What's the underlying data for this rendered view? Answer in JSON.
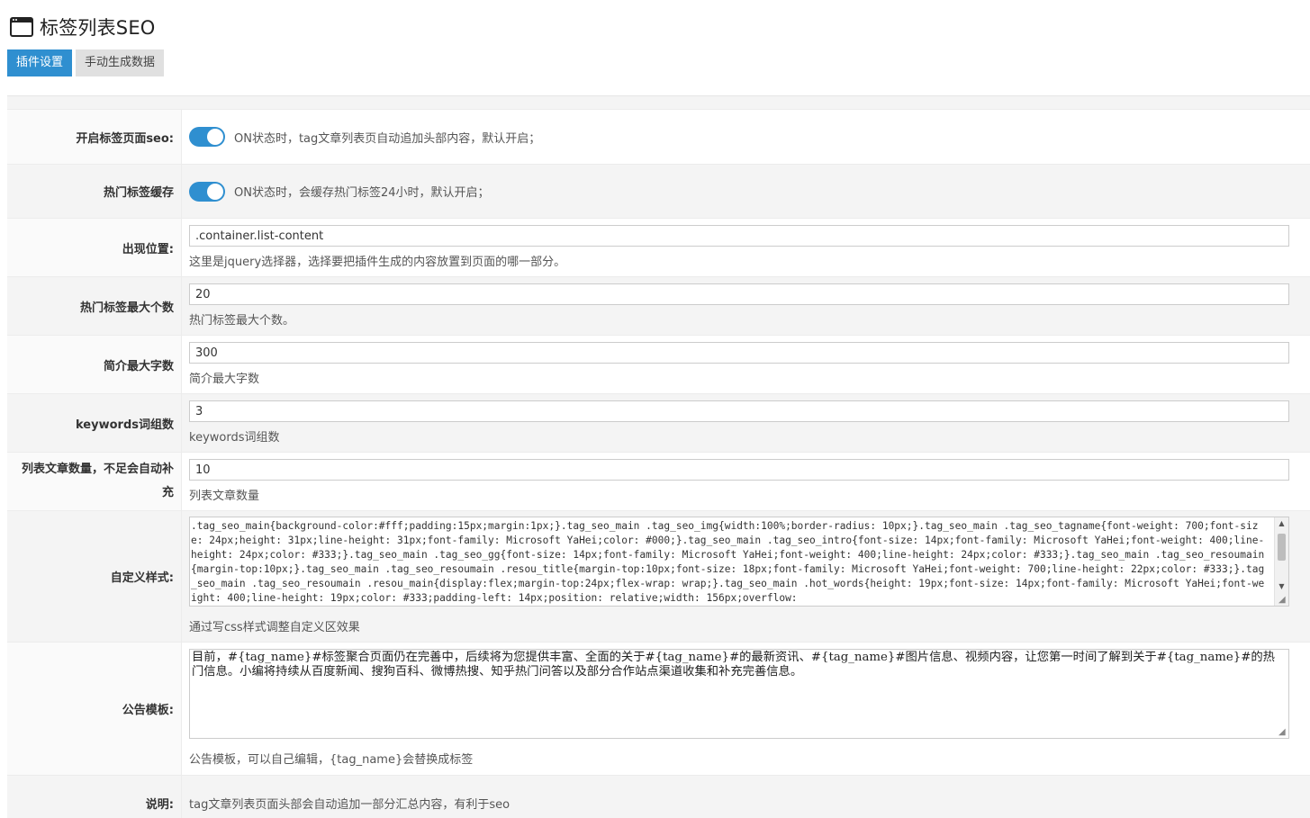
{
  "header": {
    "title": "标签列表SEO",
    "icon": "window-icon"
  },
  "tabs": [
    {
      "label": "插件设置",
      "active": true
    },
    {
      "label": "手动生成数据",
      "active": false
    }
  ],
  "settings": {
    "seo_toggle": {
      "label": "开启标签页面seo:",
      "on": true,
      "desc": "ON状态时，tag文章列表页自动追加头部内容，默认开启；"
    },
    "cache_toggle": {
      "label": "热门标签缓存",
      "on": true,
      "desc": "ON状态时，会缓存热门标签24小时，默认开启；"
    },
    "position": {
      "label": "出现位置:",
      "value": ".container.list-content",
      "help": "这里是jquery选择器，选择要把插件生成的内容放置到页面的哪一部分。"
    },
    "hot_max": {
      "label": "热门标签最大个数",
      "value": "20",
      "help": "热门标签最大个数。"
    },
    "intro_max": {
      "label": "简介最大字数",
      "value": "300",
      "help": "简介最大字数"
    },
    "keywords": {
      "label": "keywords词组数",
      "value": "3",
      "help": "keywords词组数"
    },
    "list_count": {
      "label": "列表文章数量，不足会自动补充",
      "value": "10",
      "help": "列表文章数量"
    },
    "custom_css": {
      "label": "自定义样式:",
      "value": ".tag_seo_main{background-color:#fff;padding:15px;margin:1px;}.tag_seo_main .tag_seo_img{width:100%;border-radius: 10px;}.tag_seo_main .tag_seo_tagname{font-weight: 700;font-size: 24px;height: 31px;line-height: 31px;font-family: Microsoft YaHei;color: #000;}.tag_seo_main .tag_seo_intro{font-size: 14px;font-family: Microsoft YaHei;font-weight: 400;line-height: 24px;color: #333;}.tag_seo_main .tag_seo_gg{font-size: 14px;font-family: Microsoft YaHei;font-weight: 400;line-height: 24px;color: #333;}.tag_seo_main .tag_seo_resoumain{margin-top:10px;}.tag_seo_main .tag_seo_resoumain .resou_title{margin-top:10px;font-size: 18px;font-family: Microsoft YaHei;font-weight: 700;line-height: 22px;color: #333;}.tag_seo_main .tag_seo_resoumain .resou_main{display:flex;margin-top:24px;flex-wrap: wrap;}.tag_seo_main .hot_words{height: 19px;font-size: 14px;font-family: Microsoft YaHei;font-weight: 400;line-height: 19px;color: #333;padding-left: 14px;position: relative;width: 156px;overflow:",
      "help": "通过写css样式调整自定义区效果"
    },
    "notice": {
      "label": "公告模板:",
      "value": "目前，#{tag_name}#标签聚合页面仍在完善中，后续将为您提供丰富、全面的关于#{tag_name}#的最新资讯、#{tag_name}#图片信息、视频内容，让您第一时间了解到关于#{tag_name}#的热门信息。小编将持续从百度新闻、搜狗百科、微博热搜、知乎热门问答以及部分合作站点渠道收集和补充完善信息。",
      "help": "公告模板，可以自己编辑，{tag_name}会替换成标签"
    },
    "info": {
      "label": "说明:",
      "text": "tag文章列表页面头部会自动追加一部分汇总内容，有利于seo"
    }
  }
}
